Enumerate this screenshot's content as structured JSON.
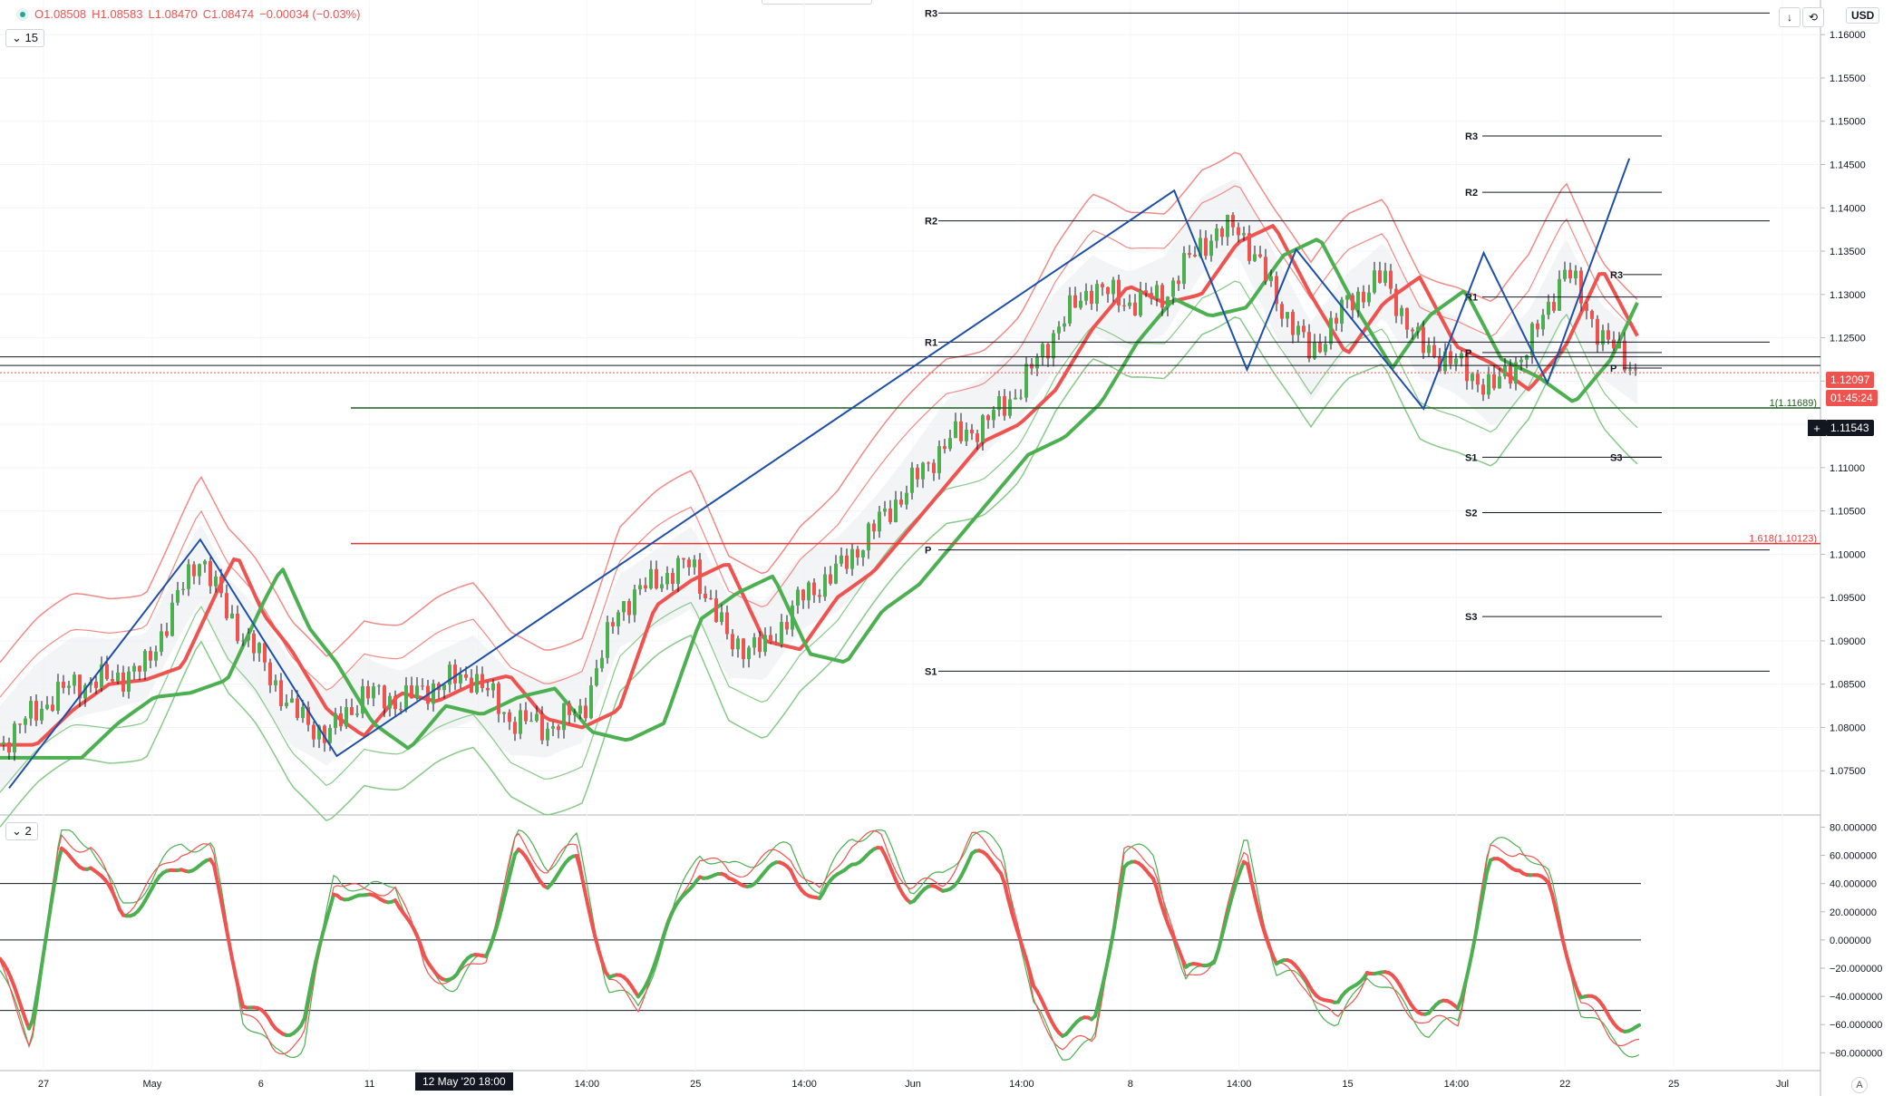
{
  "ohlc": {
    "open": "O1.08508",
    "high": "H1.08583",
    "low": "L1.08470",
    "close": "C1.08474",
    "change": "−0.00034 (−0.03%)"
  },
  "interval": "15",
  "pane2_label": "2",
  "currency": "USD",
  "buttons": {
    "down_arrow": "↓",
    "reset": "⟲",
    "cross": "+",
    "auto": "A"
  },
  "price_tags": {
    "last_price": "1.12097",
    "countdown": "01:45:24",
    "cursor_price": "1.11543"
  },
  "cursor_time_label": "12 May '20  18:00",
  "colors": {
    "up": "#4caf50",
    "down": "#ef5350",
    "pattern": "#1e4fa8",
    "upper_band": "#f08a86",
    "lower_band": "#86c987",
    "fib_red": "#e53935",
    "fib_green": "#1b5e20"
  },
  "chart_data": [
    {
      "type": "candlestick",
      "symbol_pane": "main",
      "y_axis_ticks": [
        "1.16000",
        "1.15500",
        "1.15000",
        "1.14500",
        "1.14000",
        "1.13500",
        "1.13000",
        "1.12500",
        "1.12000",
        "1.11500",
        "1.11000",
        "1.10500",
        "1.10000",
        "1.09500",
        "1.09000",
        "1.08500",
        "1.08000",
        "1.07500"
      ],
      "ylim": [
        1.07,
        1.164
      ],
      "x_axis_ticks": [
        "27",
        "May",
        "6",
        "11",
        "18",
        "14:00",
        "25",
        "14:00",
        "Jun",
        "14:00",
        "8",
        "14:00",
        "15",
        "14:00",
        "22",
        "25",
        "Jul"
      ],
      "x_axis_note": "time axis",
      "price_path": [
        [
          0,
          1.078
        ],
        [
          0.02,
          1.082
        ],
        [
          0.04,
          1.085
        ],
        [
          0.06,
          1.0855
        ],
        [
          0.08,
          1.087
        ],
        [
          0.1,
          1.096
        ],
        [
          0.11,
          1.1
        ],
        [
          0.125,
          1.093
        ],
        [
          0.14,
          1.089
        ],
        [
          0.16,
          1.082
        ],
        [
          0.18,
          1.079
        ],
        [
          0.2,
          1.084
        ],
        [
          0.22,
          1.083
        ],
        [
          0.24,
          1.085
        ],
        [
          0.26,
          1.086
        ],
        [
          0.28,
          1.081
        ],
        [
          0.3,
          1.08
        ],
        [
          0.32,
          1.082
        ],
        [
          0.34,
          1.094
        ],
        [
          0.36,
          1.097
        ],
        [
          0.38,
          1.099
        ],
        [
          0.4,
          1.09
        ],
        [
          0.42,
          1.089
        ],
        [
          0.44,
          1.095
        ],
        [
          0.46,
          1.098
        ],
        [
          0.48,
          1.103
        ],
        [
          0.5,
          1.108
        ],
        [
          0.52,
          1.113
        ],
        [
          0.54,
          1.115
        ],
        [
          0.56,
          1.119
        ],
        [
          0.58,
          1.126
        ],
        [
          0.6,
          1.131
        ],
        [
          0.62,
          1.129
        ],
        [
          0.64,
          1.13
        ],
        [
          0.66,
          1.136
        ],
        [
          0.68,
          1.138
        ],
        [
          0.7,
          1.13
        ],
        [
          0.72,
          1.123
        ],
        [
          0.74,
          1.129
        ],
        [
          0.76,
          1.132
        ],
        [
          0.78,
          1.124
        ],
        [
          0.8,
          1.122
        ],
        [
          0.82,
          1.119
        ],
        [
          0.84,
          1.124
        ],
        [
          0.86,
          1.133
        ],
        [
          0.88,
          1.125
        ],
        [
          0.9,
          1.121
        ],
        [
          0.92,
          1.1215
        ]
      ],
      "levels_left": [
        {
          "label": "R3",
          "price": 1.1625
        },
        {
          "label": "R2",
          "price": 1.1385
        },
        {
          "label": "R1",
          "price": 1.1245
        },
        {
          "label": "P",
          "price": 1.1005
        },
        {
          "label": "S1",
          "price": 1.0865
        }
      ],
      "levels_right": [
        {
          "label": "R3",
          "price": 1.1483
        },
        {
          "label": "R2",
          "price": 1.1418
        },
        {
          "label": "R1",
          "price": 1.1297
        },
        {
          "label": "P",
          "price": 1.1233
        },
        {
          "label": "S1",
          "price": 1.1112
        },
        {
          "label": "S2",
          "price": 1.1048
        },
        {
          "label": "S3",
          "price": 1.0928
        }
      ],
      "levels_far_right": [
        {
          "label": "R3",
          "price": 1.1323
        },
        {
          "label": "P",
          "price": 1.1215
        },
        {
          "label": "S3",
          "price": 1.1112
        }
      ],
      "fib_levels": [
        {
          "label": "1(1.11689)",
          "price": 1.11689,
          "color": "green"
        },
        {
          "label": "1.618(1.10123)",
          "price": 1.10123,
          "color": "red"
        }
      ],
      "horizontal_lines": [
        1.1228,
        1.1218
      ],
      "zigzag": [
        [
          0.005,
          1.073
        ],
        [
          0.11,
          1.1017
        ],
        [
          0.185,
          1.0767
        ],
        [
          0.645,
          1.142
        ],
        [
          0.685,
          1.1213
        ],
        [
          0.712,
          1.1352
        ],
        [
          0.782,
          1.1168
        ],
        [
          0.815,
          1.1348
        ],
        [
          0.85,
          1.1198
        ],
        [
          0.895,
          1.1457
        ]
      ]
    },
    {
      "type": "line",
      "symbol_pane": "oscillator",
      "y_axis_ticks": [
        "80.000000",
        "60.000000",
        "40.000000",
        "20.000000",
        "0.000000",
        "−20.000000",
        "−40.000000",
        "−60.000000",
        "−80.000000"
      ],
      "ylim": [
        -92,
        88
      ],
      "reference_lines": [
        40,
        0,
        -50
      ],
      "series": [
        {
          "values": [
            -20,
            -70,
            70,
            65,
            20,
            40,
            65,
            60,
            -50,
            -75,
            -70,
            45,
            30,
            40,
            -20,
            -30,
            -10,
            70,
            50,
            65,
            -30,
            -45,
            10,
            60,
            45,
            55,
            60,
            30,
            70,
            70,
            35,
            40,
            70,
            60,
            -45,
            -75,
            -70,
            60,
            55,
            -30,
            -10,
            65,
            -20,
            -30,
            -60,
            -20,
            -40,
            -60,
            -55,
            60,
            65,
            40,
            -45,
            -65,
            -75
          ]
        }
      ]
    }
  ]
}
